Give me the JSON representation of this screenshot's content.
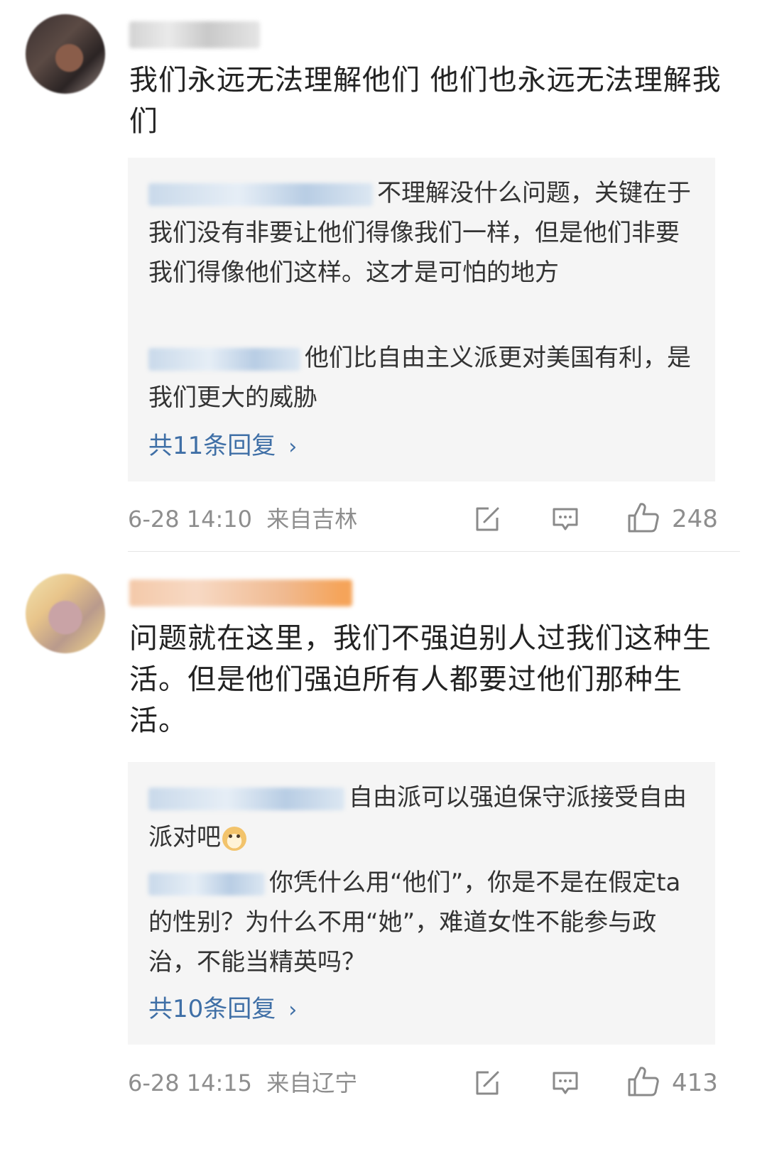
{
  "comments": [
    {
      "text": "我们永远无法理解他们 他们也永远无法理解我们",
      "replies": [
        {
          "text": "不理解没什么问题，关键在于我们没有非要让他们得像我们一样，但是他们非要我们得像他们这样。这才是可怕的地方"
        },
        {
          "text": "他们比自由主义派更对美国有利，是我们更大的威胁"
        }
      ],
      "more_replies": "共11条回复",
      "time": "6-28 14:10",
      "location": "来自吉林",
      "likes": "248"
    },
    {
      "text": "问题就在这里，我们不强迫别人过我们这种生活。但是他们强迫所有人都要过他们那种生活。",
      "replies": [
        {
          "text": "自由派可以强迫保守派接受自由派对吧"
        },
        {
          "text": "你凭什么用“他们”，你是不是在假定ta的性别？为什么不用“她”，难道女性不能参与政治，不能当精英吗？"
        }
      ],
      "more_replies": "共10条回复",
      "time": "6-28 14:15",
      "location": "来自辽宁",
      "likes": "413"
    }
  ],
  "icons": {
    "repost": "repost-icon",
    "comment": "comment-icon",
    "like": "thumbs-up-icon",
    "chevron": "chevron-right-icon"
  },
  "colors": {
    "link": "#3f6fa6",
    "meta": "#8e8e8e",
    "reply_bg": "#f5f5f5"
  }
}
